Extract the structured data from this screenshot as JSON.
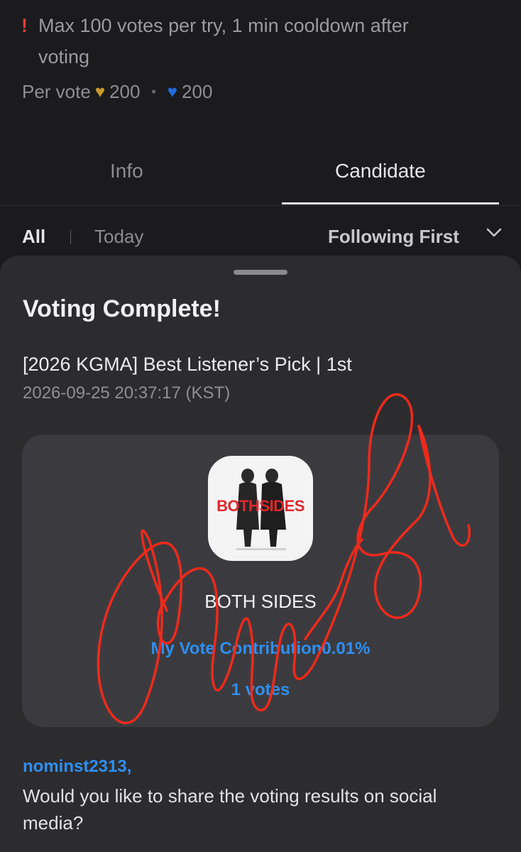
{
  "notice": {
    "icon": "exclamation-icon",
    "line1": "Max 100 votes per try, 1 min cooldown after",
    "line2": "voting"
  },
  "per_vote": {
    "label": "Per vote",
    "gold_icon": "gold-heart-icon",
    "gold_amount": "200",
    "blue_icon": "blue-heart-icon",
    "blue_amount": "200"
  },
  "tabs": [
    {
      "label": "Info",
      "active": false
    },
    {
      "label": "Candidate",
      "active": true
    }
  ],
  "filters": {
    "all": "All",
    "today": "Today",
    "sort": "Following First",
    "sort_icon": "chevron-down-icon"
  },
  "sheet": {
    "title": "Voting Complete!",
    "event": "[2026 KGMA] Best Listener’s Pick | 1st",
    "timestamp": "2026-09-25 20:37:17 (KST)",
    "candidate": {
      "thumbnail_text": "BOTHSIDES",
      "name": "BOTH SIDES",
      "contribution": "My Vote Contribution0.01%",
      "votes": "1 votes"
    },
    "username": "nominst2313,",
    "share_prompt": "Would you like to share the voting results on social media?"
  },
  "colors": {
    "background": "#1b1b1d",
    "sheet": "#2c2c2f",
    "card": "#3b3b3f",
    "accent_blue": "#2f8ff0",
    "gold": "#c89a2a",
    "warning_red": "#e5393a",
    "scribble_red": "#ee2a1c"
  }
}
